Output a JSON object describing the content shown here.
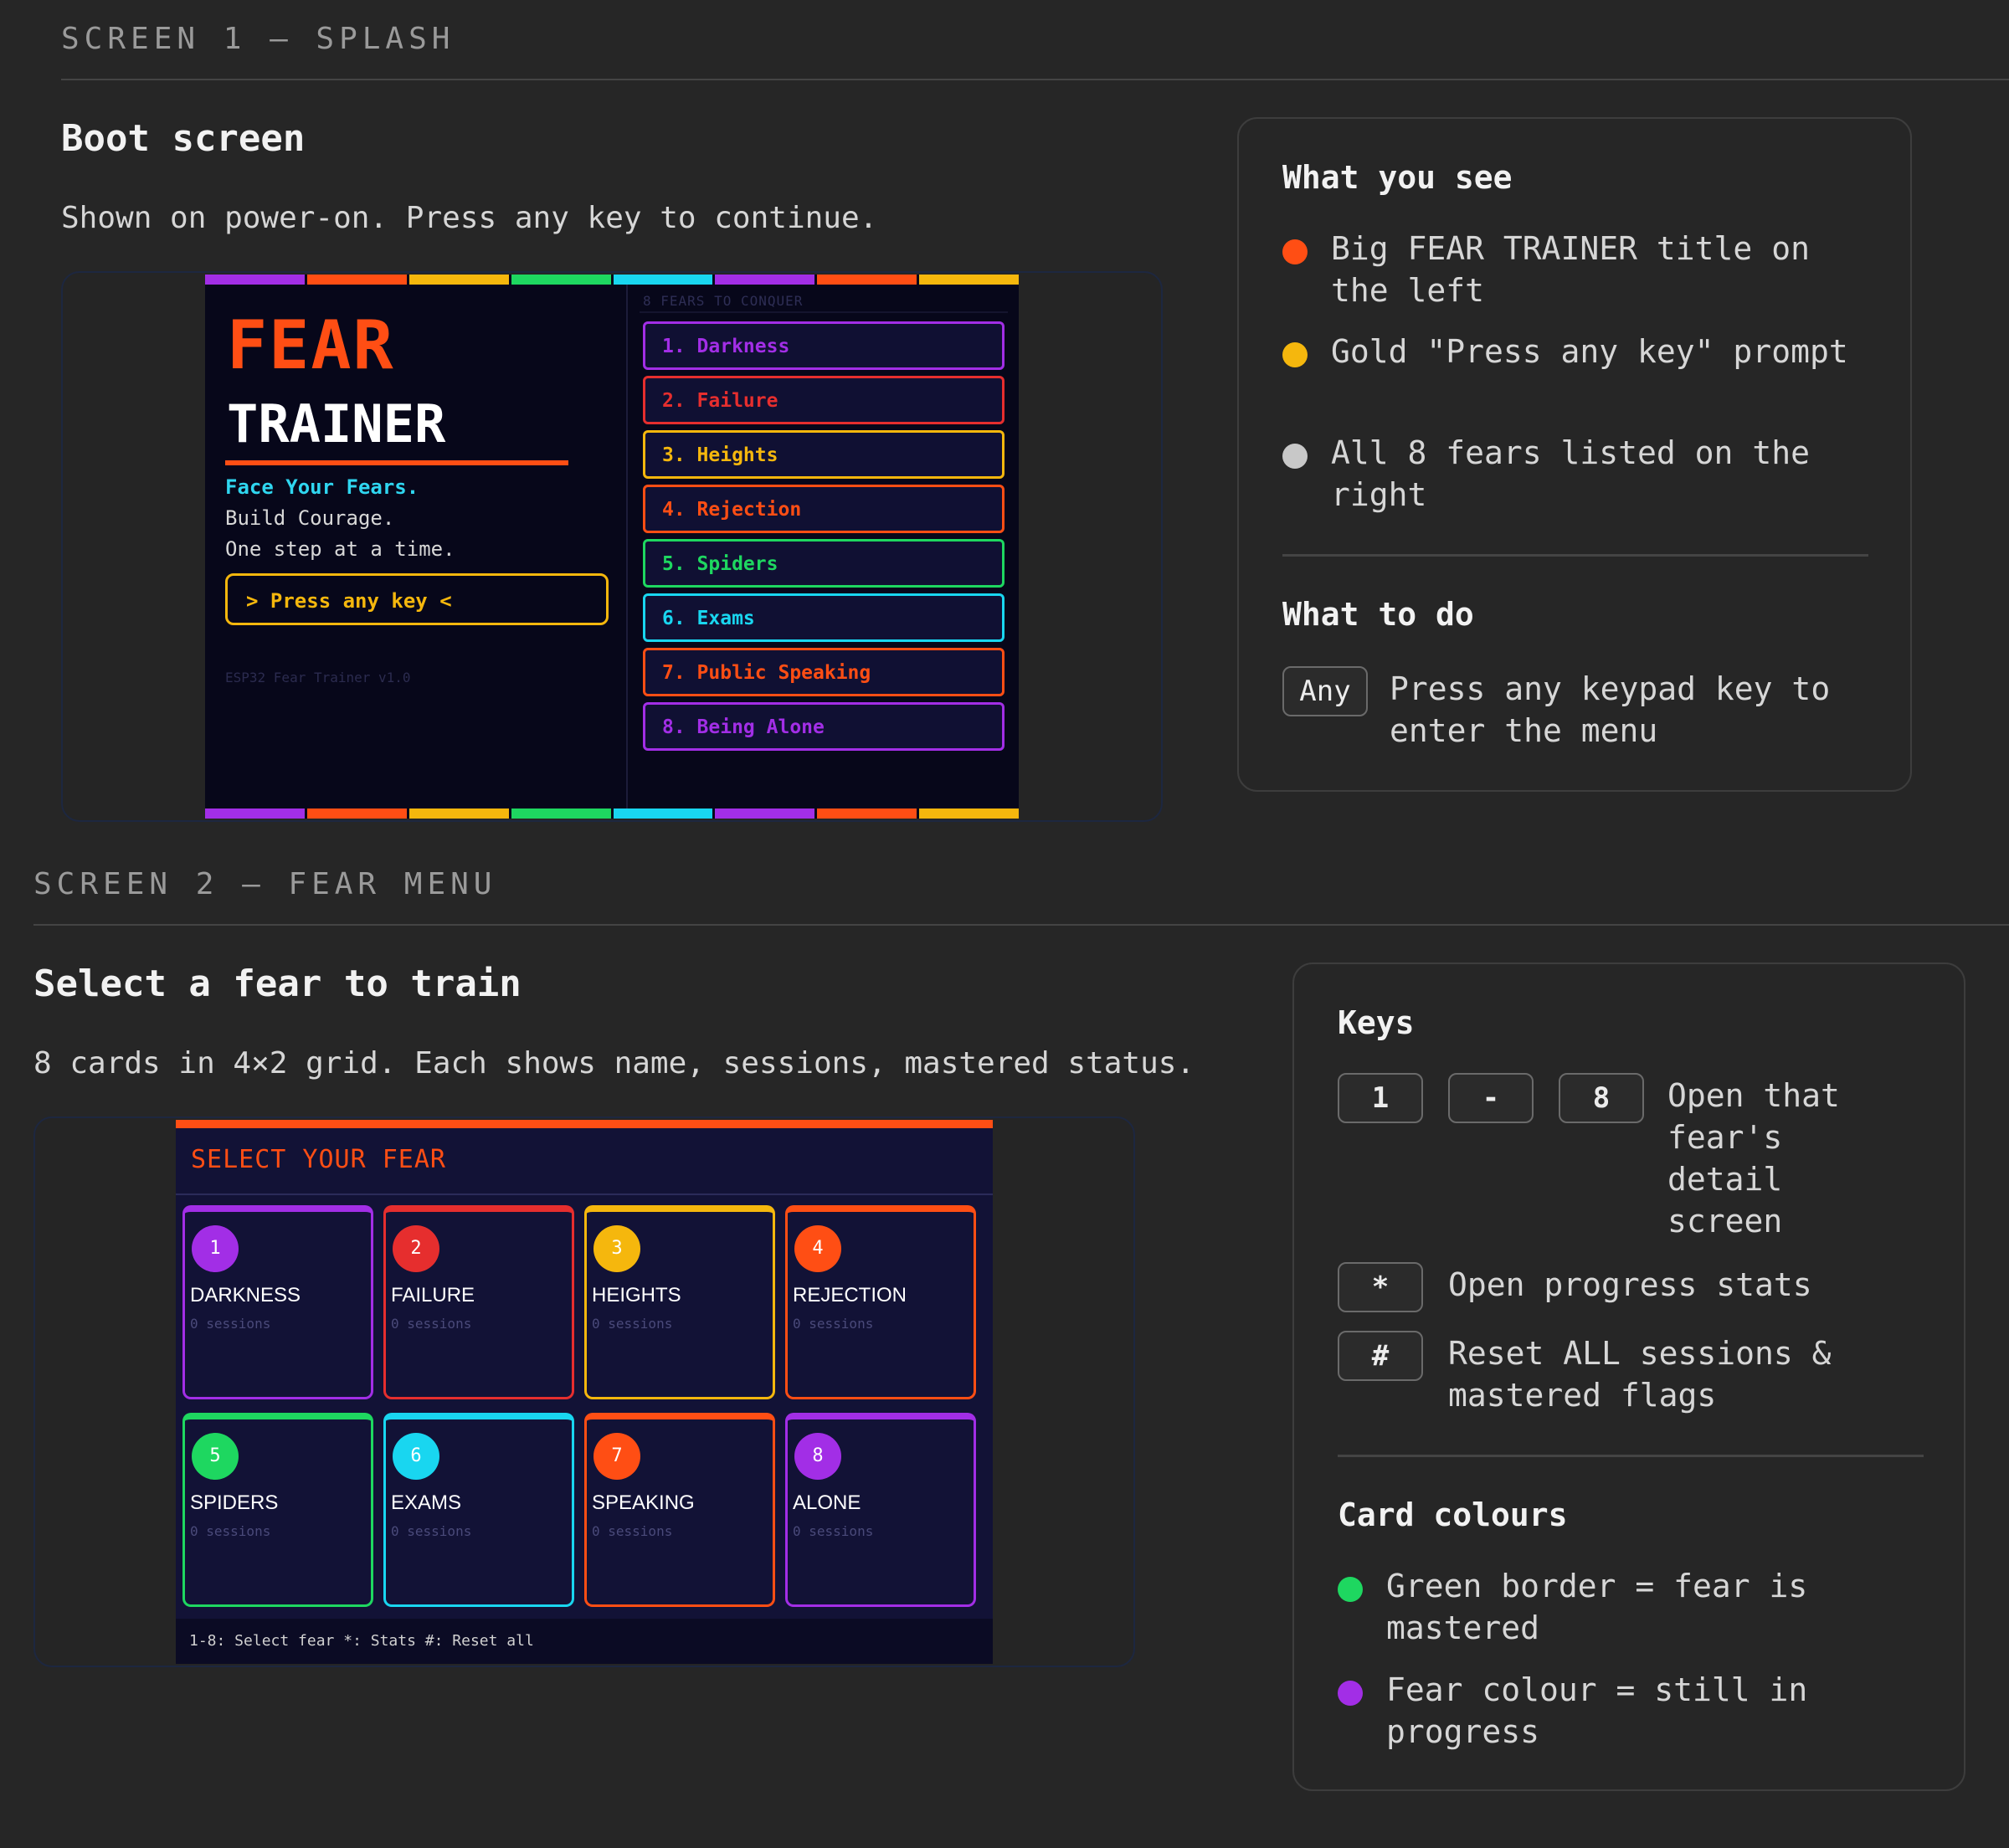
{
  "screen1": {
    "label": "SCREEN 1 — SPLASH",
    "title": "Boot screen",
    "desc": "Shown on power-on. Press any key to continue.",
    "mock": {
      "title_line1": "FEAR",
      "title_line2": "TRAINER",
      "tagline1": "Face Your Fears.",
      "tagline2": "Build Courage.",
      "tagline3": "One step at a time.",
      "prompt": "> Press any key <",
      "version": "ESP32 Fear Trainer v1.0",
      "fears_header": "8 FEARS TO CONQUER",
      "fears": [
        {
          "label": "1. Darkness",
          "color": "#a22ee6"
        },
        {
          "label": "2. Failure",
          "color": "#e62e2e"
        },
        {
          "label": "3. Heights",
          "color": "#f5b70d"
        },
        {
          "label": "4. Rejection",
          "color": "#ff4e14"
        },
        {
          "label": "5. Spiders",
          "color": "#1ed760"
        },
        {
          "label": "6. Exams",
          "color": "#19d6f0"
        },
        {
          "label": "7. Public Speaking",
          "color": "#ff4e14"
        },
        {
          "label": "8. Being Alone",
          "color": "#a22ee6"
        }
      ]
    },
    "panel": {
      "see_heading": "What you see",
      "see_items": [
        {
          "text": "Big FEAR TRAINER title on the left",
          "color": "#ff4e14"
        },
        {
          "text": "Gold \"Press any key\" prompt",
          "color": "#f5b70d"
        },
        {
          "text": "All 8 fears listed on the right",
          "color": "#c8c8c8"
        }
      ],
      "do_heading": "What to do",
      "do_key": "Any",
      "do_text": "Press any keypad key to enter the menu"
    }
  },
  "screen2": {
    "label": "SCREEN 2 — FEAR MENU",
    "title": "Select a fear to train",
    "desc": "8 cards in 4×2 grid. Each shows name, sessions, mastered status.",
    "mock": {
      "title": "SELECT YOUR FEAR",
      "footer": "1-8: Select fear  *: Stats  #: Reset all",
      "cards": [
        {
          "num": "1",
          "name": "DARKNESS",
          "sessions": "0 sessions",
          "color": "#a22ee6"
        },
        {
          "num": "2",
          "name": "FAILURE",
          "sessions": "0 sessions",
          "color": "#e62e2e"
        },
        {
          "num": "3",
          "name": "HEIGHTS",
          "sessions": "0 sessions",
          "color": "#f5b70d"
        },
        {
          "num": "4",
          "name": "REJECTION",
          "sessions": "0 sessions",
          "color": "#ff4e14"
        },
        {
          "num": "5",
          "name": "SPIDERS",
          "sessions": "0 sessions",
          "color": "#1ed760"
        },
        {
          "num": "6",
          "name": "EXAMS",
          "sessions": "0 sessions",
          "color": "#19d6f0"
        },
        {
          "num": "7",
          "name": "SPEAKING",
          "sessions": "0 sessions",
          "color": "#ff4e14"
        },
        {
          "num": "8",
          "name": "ALONE",
          "sessions": "0 sessions",
          "color": "#a22ee6"
        }
      ]
    },
    "panel": {
      "keys_heading": "Keys",
      "key_1": "1",
      "key_dash": "-",
      "key_8": "8",
      "key_range_desc": "Open that fear's detail screen",
      "key_star": "*",
      "key_star_desc": "Open progress stats",
      "key_hash": "#",
      "key_hash_desc": "Reset ALL sessions & mastered flags",
      "colours_heading": "Card colours",
      "colour_items": [
        {
          "text": "Green border = fear is mastered",
          "color": "#1ed760"
        },
        {
          "text": "Fear colour = still in progress",
          "color": "#a22ee6"
        }
      ]
    }
  }
}
